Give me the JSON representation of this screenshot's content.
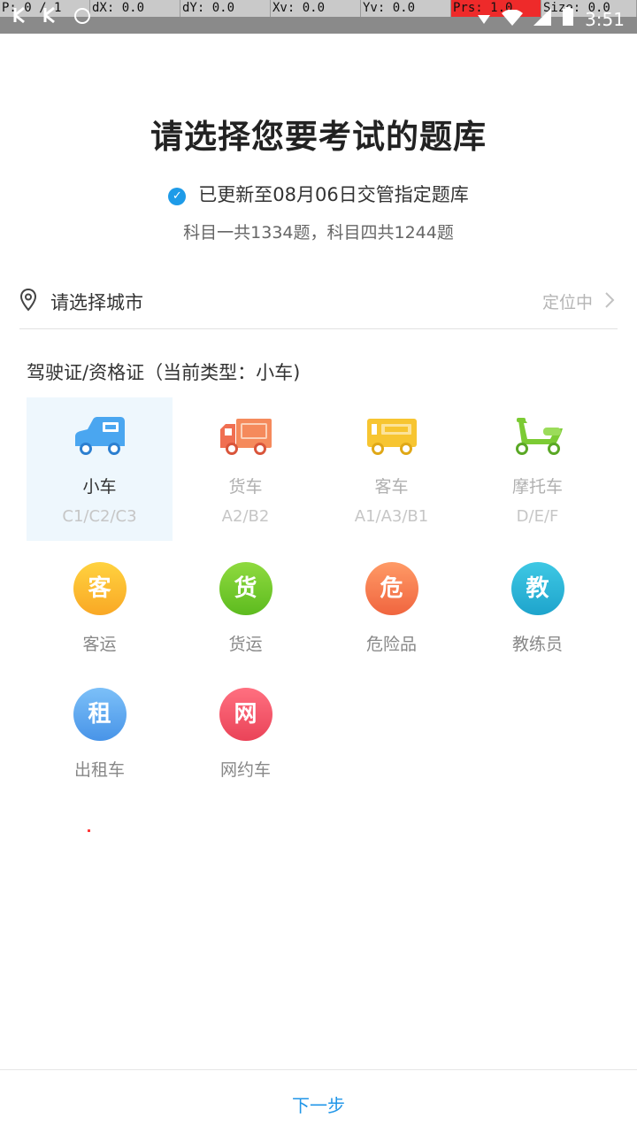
{
  "debug": {
    "p": "P: 0 / 1",
    "dx": "dX: 0.0",
    "dy": "dY: 0.0",
    "xv": "Xv: 0.0",
    "yv": "Yv: 0.0",
    "prs": "Prs: 1.0",
    "size": "Size: 0.0"
  },
  "status": {
    "time": "3:51"
  },
  "header": {
    "title": "请选择您要考试的题库",
    "update_text": "已更新至08月06日交管指定题库",
    "count_text": "科目一共1334题，科目四共1244题"
  },
  "city": {
    "label": "请选择城市",
    "status": "定位中"
  },
  "section": {
    "label": "驾驶证/资格证（当前类型：小车)"
  },
  "vehicles": [
    {
      "name": "小车",
      "code": "C1/C2/C3",
      "color": "#4aa6f0"
    },
    {
      "name": "货车",
      "code": "A2/B2",
      "color": "#f58a5c"
    },
    {
      "name": "客车",
      "code": "A1/A3/B1",
      "color": "#f7c531"
    },
    {
      "name": "摩托车",
      "code": "D/E/F",
      "color": "#7ccb34"
    }
  ],
  "qualifications": [
    {
      "char": "客",
      "name": "客运",
      "color": "#fbb53a"
    },
    {
      "char": "货",
      "name": "货运",
      "color": "#7ccb34"
    },
    {
      "char": "危",
      "name": "危险品",
      "color": "#f57b55"
    },
    {
      "char": "教",
      "name": "教练员",
      "color": "#2fb4d8"
    },
    {
      "char": "租",
      "name": "出租车",
      "color": "#5fa8f0"
    },
    {
      "char": "网",
      "name": "网约车",
      "color": "#f3576a"
    }
  ],
  "footer": {
    "next_label": "下一步"
  }
}
